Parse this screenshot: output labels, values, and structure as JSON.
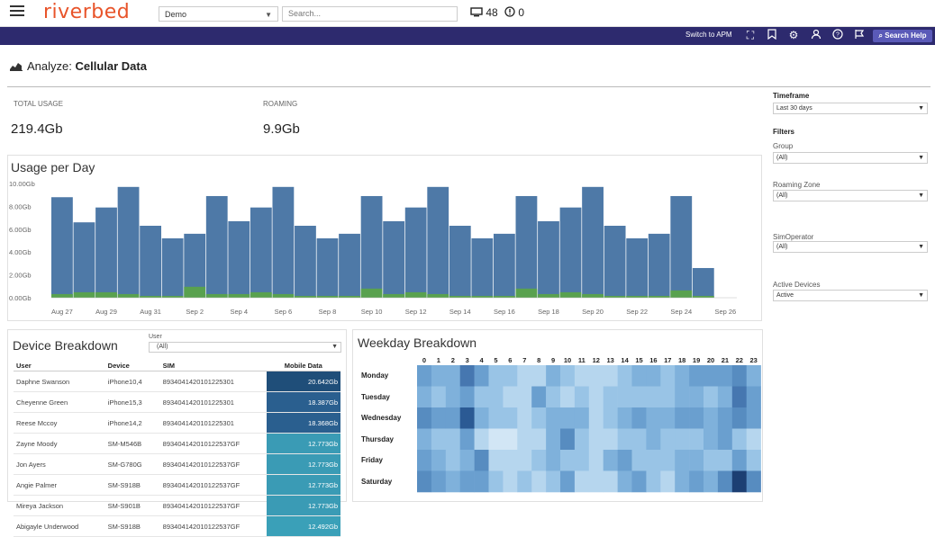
{
  "topbar": {
    "logo": "riverbed",
    "org_select": "Demo",
    "search_placeholder": "Search...",
    "monitor_count": "48",
    "alert_count": "0"
  },
  "navbar": {
    "switch_label": "Switch to APM",
    "search_help_label": "Search Help",
    "icons": [
      "expand-icon",
      "bookmark-icon",
      "gear-icon",
      "user-icon",
      "help-icon",
      "flag-icon"
    ]
  },
  "page": {
    "title_prefix": "Analyze: ",
    "title": "Cellular Data"
  },
  "kpis": [
    {
      "label": "TOTAL USAGE",
      "value": "219.4Gb"
    },
    {
      "label": "ROAMING",
      "value": "9.9Gb"
    }
  ],
  "usage_chart": {
    "title": "Usage per Day"
  },
  "chart_data": [
    {
      "type": "bar",
      "title": "Usage per Day",
      "y_ticks": [
        "10.00Gb",
        "8.00Gb",
        "6.00Gb",
        "4.00Gb",
        "2.00Gb",
        "0.00Gb"
      ],
      "ylim": [
        0,
        10
      ],
      "x_tick_labels": [
        "Aug 27",
        "Aug 29",
        "Aug 31",
        "Sep 2",
        "Sep 4",
        "Sep 6",
        "Sep 8",
        "Sep 10",
        "Sep 12",
        "Sep 14",
        "Sep 16",
        "Sep 18",
        "Sep 20",
        "Sep 22",
        "Sep 24",
        "Sep 26"
      ],
      "categories": [
        "Aug 27",
        "Aug 28",
        "Aug 29",
        "Aug 30",
        "Aug 31",
        "Sep 1",
        "Sep 2",
        "Sep 3",
        "Sep 4",
        "Sep 5",
        "Sep 6",
        "Sep 7",
        "Sep 8",
        "Sep 9",
        "Sep 10",
        "Sep 11",
        "Sep 12",
        "Sep 13",
        "Sep 14",
        "Sep 15",
        "Sep 16",
        "Sep 17",
        "Sep 18",
        "Sep 19",
        "Sep 20",
        "Sep 21",
        "Sep 22",
        "Sep 23",
        "Sep 24",
        "Sep 25",
        "Sep 26"
      ],
      "series": [
        {
          "values": [
            8.8,
            6.6,
            7.9,
            9.7,
            6.3,
            5.2,
            5.6,
            8.9,
            6.7,
            7.9,
            9.7,
            6.3,
            5.2,
            5.6,
            8.9,
            6.7,
            7.9,
            9.7,
            6.3,
            5.2,
            5.6,
            8.9,
            6.7,
            7.9,
            9.7,
            6.3,
            5.2,
            5.6,
            8.9,
            2.6,
            0
          ]
        },
        {
          "values": [
            0.2,
            0.3,
            0.3,
            0.2,
            0.1,
            0.1,
            0.6,
            0.2,
            0.2,
            0.3,
            0.2,
            0.1,
            0.1,
            0.1,
            0.5,
            0.2,
            0.3,
            0.2,
            0.1,
            0.1,
            0.1,
            0.5,
            0.2,
            0.3,
            0.2,
            0.1,
            0.1,
            0.1,
            0.4,
            0.1,
            0
          ]
        }
      ],
      "colors": [
        "#4e79a7",
        "#59a14f"
      ]
    },
    {
      "type": "heatmap",
      "title": "Weekday Breakdown",
      "x": [
        "0",
        "1",
        "2",
        "3",
        "4",
        "5",
        "6",
        "7",
        "8",
        "9",
        "10",
        "11",
        "12",
        "13",
        "14",
        "15",
        "16",
        "17",
        "18",
        "19",
        "20",
        "21",
        "22",
        "23"
      ],
      "y": [
        "Monday",
        "Tuesday",
        "Wednesday",
        "Thursday",
        "Friday",
        "Saturday"
      ],
      "values": [
        [
          5,
          4,
          4,
          7,
          5,
          3,
          3,
          2,
          2,
          4,
          3,
          2,
          2,
          2,
          3,
          4,
          4,
          3,
          4,
          5,
          5,
          5,
          6,
          4
        ],
        [
          4,
          3,
          4,
          5,
          3,
          3,
          2,
          2,
          5,
          3,
          2,
          3,
          2,
          3,
          3,
          3,
          3,
          3,
          4,
          4,
          3,
          4,
          7,
          5
        ],
        [
          6,
          5,
          5,
          8,
          4,
          3,
          3,
          2,
          3,
          4,
          4,
          4,
          2,
          3,
          4,
          5,
          4,
          4,
          5,
          5,
          4,
          5,
          6,
          5
        ],
        [
          4,
          3,
          3,
          5,
          2,
          1,
          1,
          2,
          2,
          4,
          6,
          3,
          2,
          2,
          3,
          3,
          4,
          3,
          3,
          3,
          4,
          5,
          3,
          2
        ],
        [
          5,
          4,
          3,
          4,
          6,
          2,
          2,
          2,
          3,
          4,
          3,
          3,
          2,
          4,
          5,
          3,
          3,
          3,
          4,
          4,
          3,
          3,
          5,
          3
        ],
        [
          6,
          5,
          4,
          5,
          5,
          3,
          2,
          3,
          2,
          3,
          5,
          2,
          2,
          2,
          4,
          5,
          3,
          2,
          4,
          5,
          4,
          6,
          9,
          6
        ]
      ]
    }
  ],
  "device_breakdown": {
    "title": "Device Breakdown",
    "user_filter_label": "User",
    "user_filter_value": "(All)",
    "columns": [
      "User",
      "Device",
      "SIM",
      "Mobile Data"
    ],
    "rows": [
      {
        "user": "Daphne Swanson",
        "device": "iPhone10,4",
        "sim": "8934041420101225301",
        "data": "20.642Gb",
        "color": "#1f4e79"
      },
      {
        "user": "Cheyenne Green",
        "device": "iPhone15,3",
        "sim": "8934041420101225301",
        "data": "18.387Gb",
        "color": "#2a5f8f"
      },
      {
        "user": "Reese Mccoy",
        "device": "iPhone14,2",
        "sim": "8934041420101225301",
        "data": "18.368Gb",
        "color": "#2a5f8f"
      },
      {
        "user": "Zayne Moody",
        "device": "SM-M546B",
        "sim": "893404142010122537GF",
        "data": "12.773Gb",
        "color": "#3a9bb5"
      },
      {
        "user": "Jon Ayers",
        "device": "SM-G780G",
        "sim": "893404142010122537GF",
        "data": "12.773Gb",
        "color": "#3a9bb5"
      },
      {
        "user": "Angie Palmer",
        "device": "SM-S918B",
        "sim": "893404142010122537GF",
        "data": "12.773Gb",
        "color": "#3a9bb5"
      },
      {
        "user": "Mireya Jackson",
        "device": "SM-S901B",
        "sim": "893404142010122537GF",
        "data": "12.773Gb",
        "color": "#3a9bb5"
      },
      {
        "user": "Abigayle Underwood",
        "device": "SM-S918B",
        "sim": "893404142010122537GF",
        "data": "12.492Gb",
        "color": "#3aa0b8"
      }
    ]
  },
  "weekday_breakdown": {
    "title": "Weekday Breakdown"
  },
  "sidebar": {
    "timeframe_label": "Timeframe",
    "timeframe_value": "Last 30 days",
    "filters_label": "Filters",
    "filters": [
      {
        "label": "Group",
        "value": "(All)"
      },
      {
        "label": "Roaming Zone",
        "value": "(All)"
      },
      {
        "label": "SimOperator",
        "value": "(All)"
      },
      {
        "label": "Active Devices",
        "value": "Active"
      }
    ]
  }
}
